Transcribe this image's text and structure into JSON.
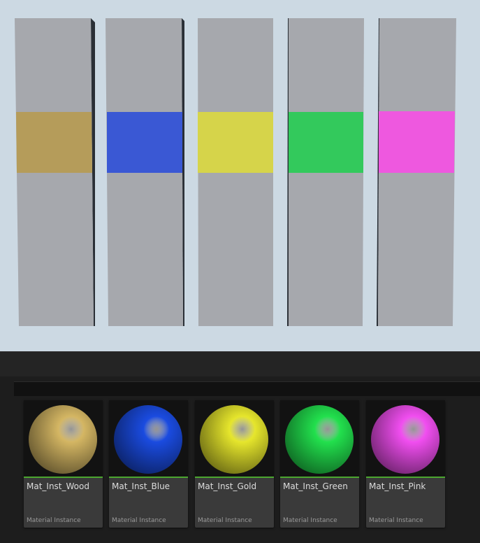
{
  "viewport": {
    "pillars": [
      {
        "name": "wood",
        "color": "#b59c5a"
      },
      {
        "name": "blue",
        "color": "#3a58d4"
      },
      {
        "name": "gold",
        "color": "#d6d44a"
      },
      {
        "name": "green",
        "color": "#33c95c"
      },
      {
        "name": "pink",
        "color": "#ee58df"
      }
    ]
  },
  "content_browser": {
    "assets": [
      {
        "name": "Mat_Inst_Wood",
        "type": "Material Instance",
        "color": "#d4b663"
      },
      {
        "name": "Mat_Inst_Blue",
        "type": "Material Instance",
        "color": "#1a4be0"
      },
      {
        "name": "Mat_Inst_Gold",
        "type": "Material Instance",
        "color": "#e6e62c"
      },
      {
        "name": "Mat_Inst_Green",
        "type": "Material Instance",
        "color": "#22e04d"
      },
      {
        "name": "Mat_Inst_Pink",
        "type": "Material Instance",
        "color": "#f14ef0"
      }
    ]
  }
}
